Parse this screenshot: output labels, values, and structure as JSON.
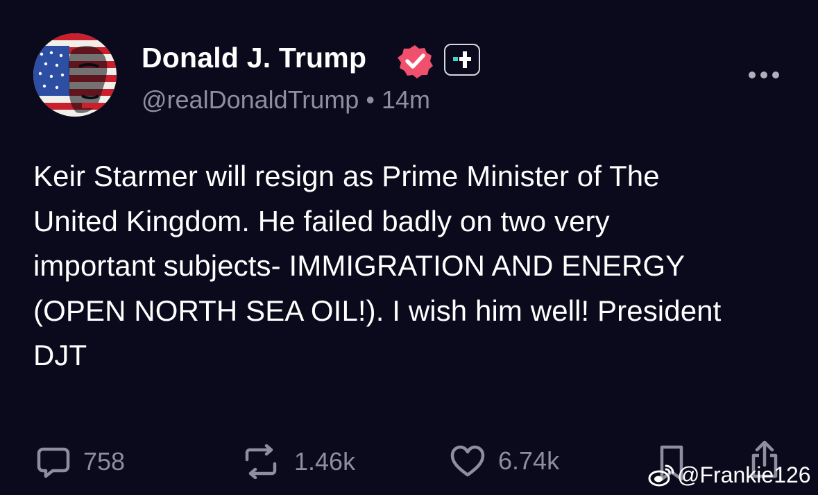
{
  "author": {
    "display_name": "Donald J. Trump",
    "handle": "@realDonaldTrump",
    "separator": "•",
    "time_ago": "14m",
    "verified": true
  },
  "post": {
    "text": "Keir Starmer will resign as Prime Minister of The\nUnited Kingdom. He failed badly on two very\nimportant subjects- IMMIGRATION AND ENERGY\n(OPEN NORTH SEA OIL!). I wish him well! President\nDJT"
  },
  "actions": {
    "replies": "758",
    "reposts": "1.46k",
    "likes": "6.74k"
  },
  "watermark": {
    "text": "@Frankie126"
  },
  "colors": {
    "background": "#0a0a1c",
    "text": "#ffffff",
    "muted": "#8e8e9e",
    "verified_badge": "#f0506e",
    "plus_accent": "#3dd9c4"
  },
  "icons": [
    "more-icon",
    "verified-icon",
    "plus-icon",
    "reply-icon",
    "repost-icon",
    "like-icon",
    "bookmark-icon",
    "share-icon",
    "weibo-icon"
  ]
}
